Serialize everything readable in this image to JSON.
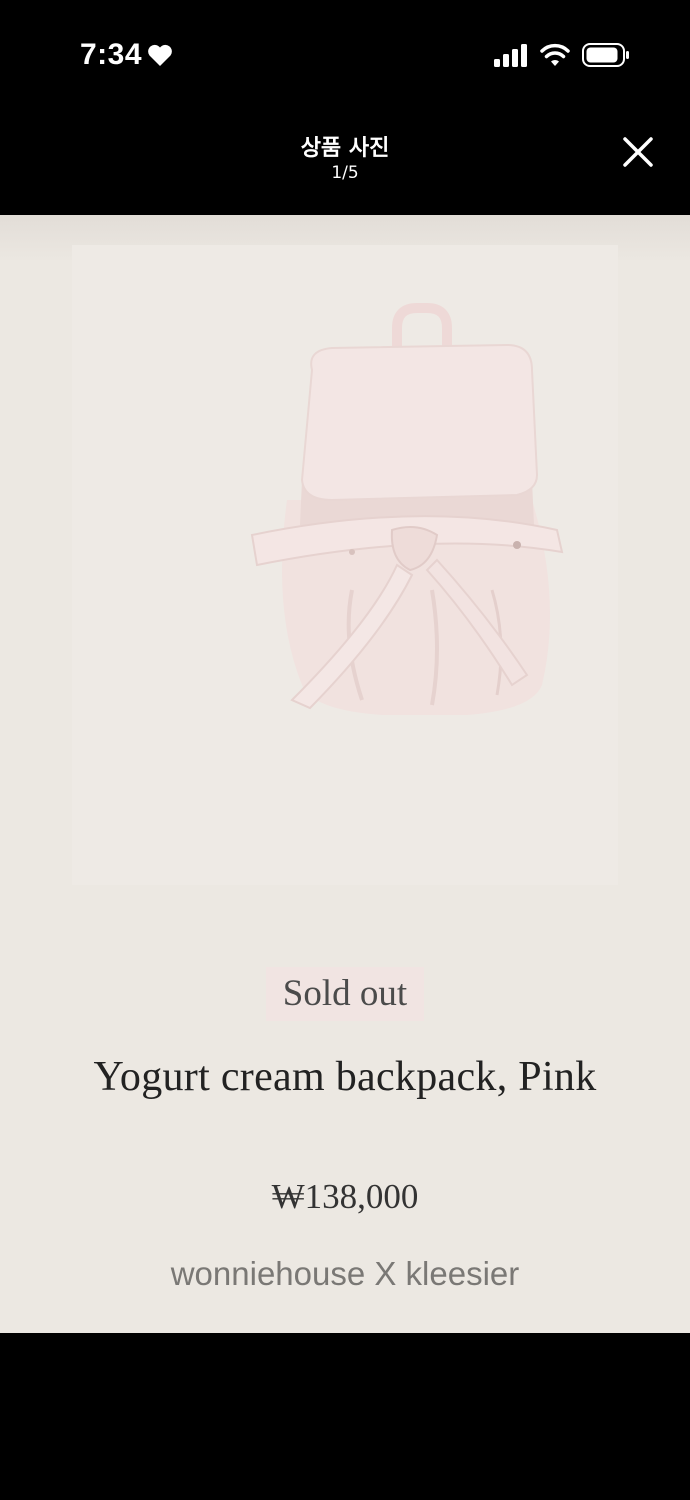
{
  "status_bar": {
    "time": "7:34",
    "heart_icon": "heart-icon",
    "signal_icon": "cellular-signal-icon",
    "wifi_icon": "wifi-icon",
    "battery_icon": "battery-icon"
  },
  "viewer": {
    "title": "상품 사진",
    "counter": "1/5",
    "close_icon": "close-icon"
  },
  "product": {
    "badge": "Sold out",
    "name": "Yogurt cream backpack, Pink",
    "price": "₩138,000",
    "brand": "wonniehouse X kleesier",
    "image_icon": "pink-backpack-image"
  },
  "colors": {
    "header_bg": "#000000",
    "photo_bg": "#ece8e2",
    "badge_bg": "#f1e4e2",
    "backpack_pink": "#f1e1df"
  }
}
